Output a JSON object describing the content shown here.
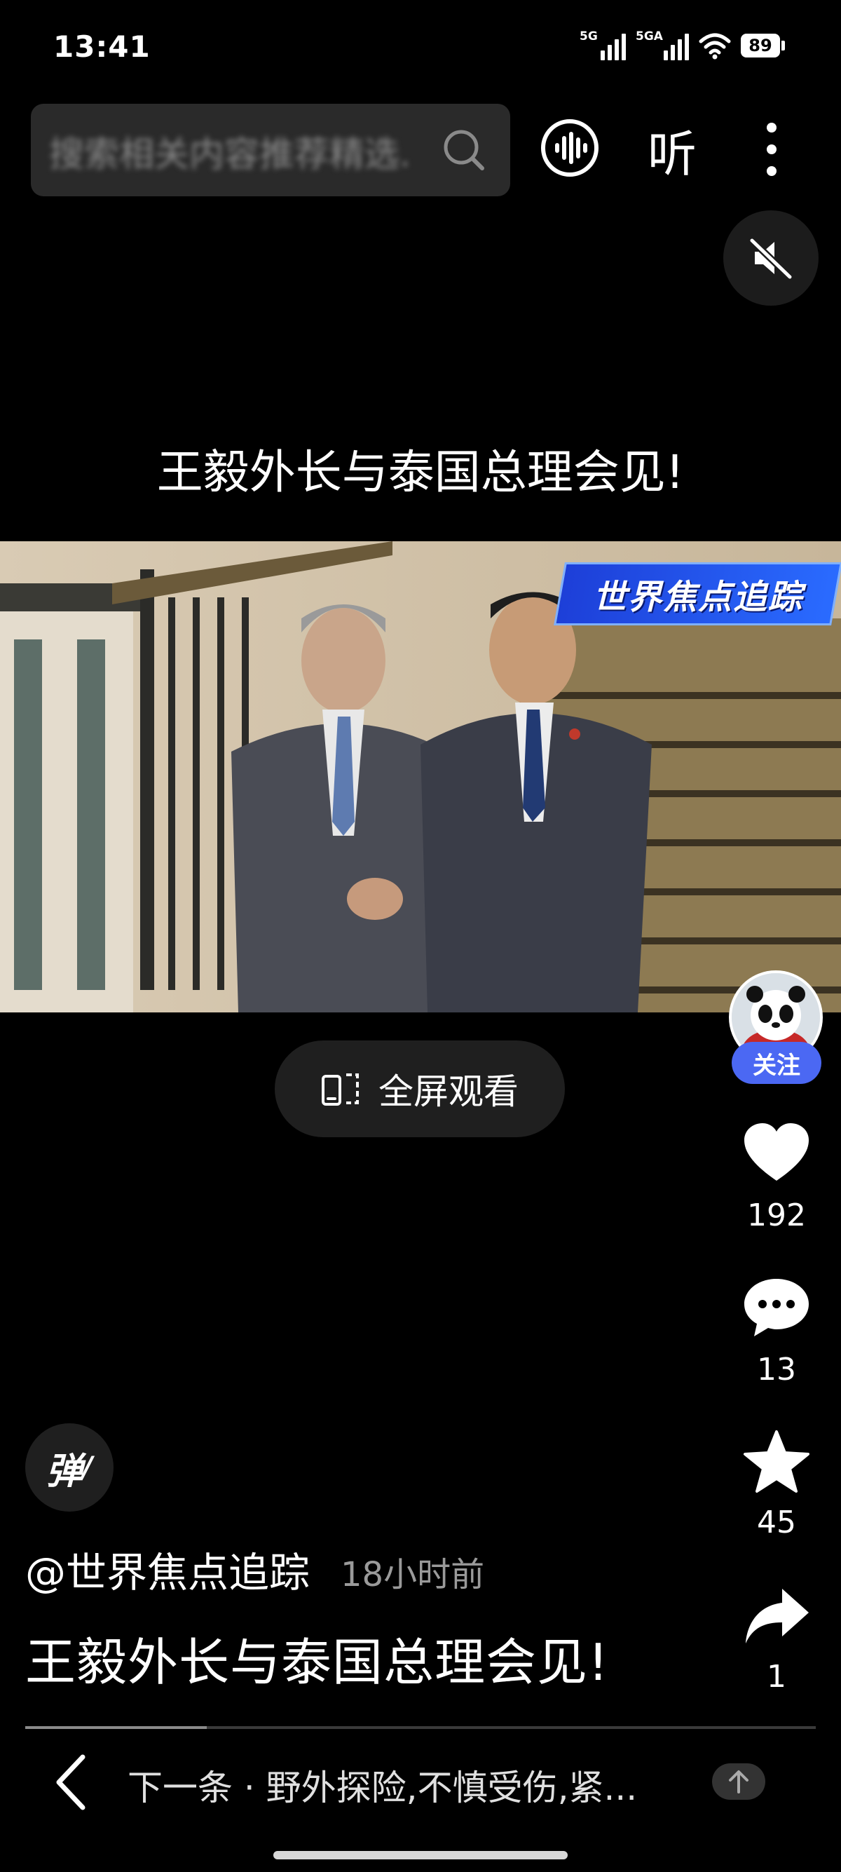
{
  "status_bar": {
    "time": "13:41",
    "network1": "5G",
    "network2": "5GA",
    "battery": "89"
  },
  "search": {
    "placeholder": "搜索相关内容推荐精选..."
  },
  "toolbar": {
    "listen_label": "听"
  },
  "video": {
    "title": "王毅外长与泰国总理会见!",
    "channel_banner": "世界焦点追踪",
    "fullscreen_label": "全屏观看"
  },
  "rail": {
    "follow_label": "关注",
    "likes": "192",
    "comments": "13",
    "favorites": "45",
    "shares": "1"
  },
  "post": {
    "danmaku_label": "弹",
    "author": "@世界焦点追踪",
    "time_ago": "18小时前",
    "caption": "王毅外长与泰国总理会见!",
    "playback_progress": 0.23
  },
  "next": {
    "text": "下一条 · 野外探险,不慎受伤,紧..."
  },
  "colors": {
    "background": "#000000",
    "follow_accent": "#4b68f3",
    "banner_blue": "#2a6bff"
  }
}
